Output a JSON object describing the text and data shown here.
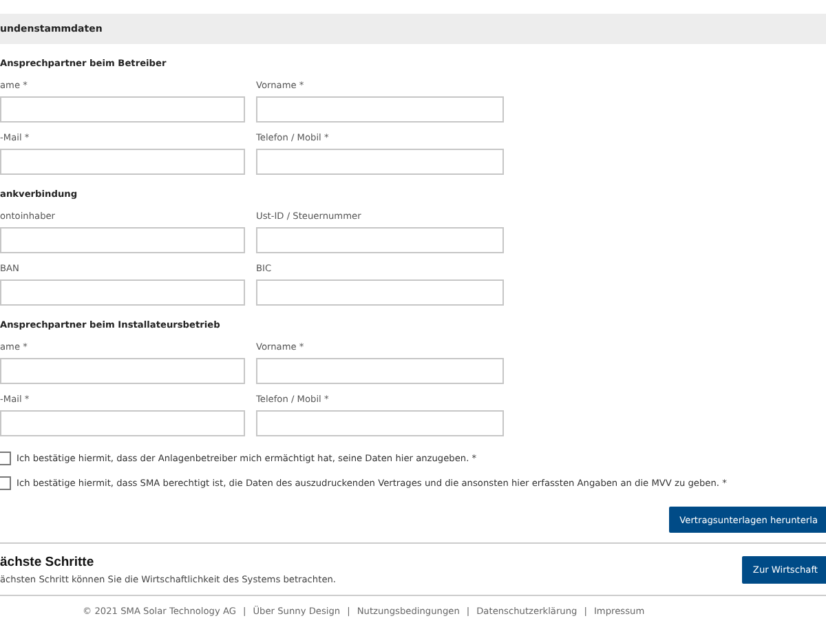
{
  "header": {
    "title": "undenstammdaten"
  },
  "sections": [
    {
      "title": "Ansprechpartner beim Betreiber",
      "fields": [
        {
          "label": "ame *"
        },
        {
          "label": "Vorname *"
        },
        {
          "label": "-Mail *"
        },
        {
          "label": "Telefon / Mobil *"
        }
      ]
    },
    {
      "title": "ankverbindung",
      "fields": [
        {
          "label": "ontoinhaber"
        },
        {
          "label": "Ust-ID / Steuernummer"
        },
        {
          "label": "BAN"
        },
        {
          "label": "BIC"
        }
      ]
    },
    {
      "title": "Ansprechpartner beim Installateursbetrieb",
      "fields": [
        {
          "label": "ame *"
        },
        {
          "label": "Vorname *"
        },
        {
          "label": "-Mail *"
        },
        {
          "label": "Telefon / Mobil *"
        }
      ]
    }
  ],
  "consents": [
    {
      "label": "Ich bestätige hiermit, dass der Anlagenbetreiber mich ermächtigt hat, seine Daten hier anzugeben. *",
      "checked": false
    },
    {
      "label": "Ich bestätige hiermit, dass SMA berechtigt ist, die Daten des auszudruckenden Vertrages und die ansonsten hier erfassten Angaben an die MVV zu geben. *",
      "checked": false
    }
  ],
  "download_button": "Vertragsunterlagen herunterla",
  "next_steps": {
    "title": "ächste Schritte",
    "text": "ächsten Schritt können Sie die Wirtschaftlichkeit des Systems betrachten.",
    "button": "Zur Wirtschaft"
  },
  "footer": {
    "separators": [
      "|",
      "|",
      "|",
      "|"
    ],
    "links": [
      "© 2021 SMA Solar Technology AG",
      "Über Sunny Design",
      "Nutzungsbedingungen",
      "Datenschutzerklärung",
      "Impressum"
    ]
  }
}
